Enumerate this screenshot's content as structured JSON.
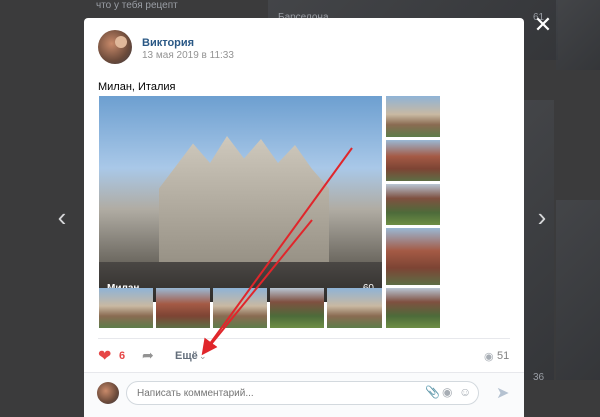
{
  "background": {
    "captions": [
      "Барселона",
      "61",
      "36",
      "что у тебя рецепт"
    ]
  },
  "post": {
    "author": "Виктория",
    "date": "13 мая 2019 в 11:33",
    "text": "Милан, Италия",
    "main_photo": {
      "label": "Милан",
      "count": "60"
    }
  },
  "actions": {
    "likes": "6",
    "more_label": "Ещё",
    "views": "51"
  },
  "comment": {
    "placeholder": "Написать комментарий..."
  },
  "icons": {
    "close": "close-icon",
    "prev": "chevron-left-icon",
    "next": "chevron-right-icon",
    "heart": "heart-icon",
    "share": "share-icon",
    "eye": "eye-icon",
    "attach": "paperclip-icon",
    "camera": "camera-icon",
    "emoji": "smile-icon",
    "send": "send-icon"
  },
  "colors": {
    "accent": "#2a5885",
    "like": "#e64646",
    "annotation_arrow": "#e0262b"
  }
}
